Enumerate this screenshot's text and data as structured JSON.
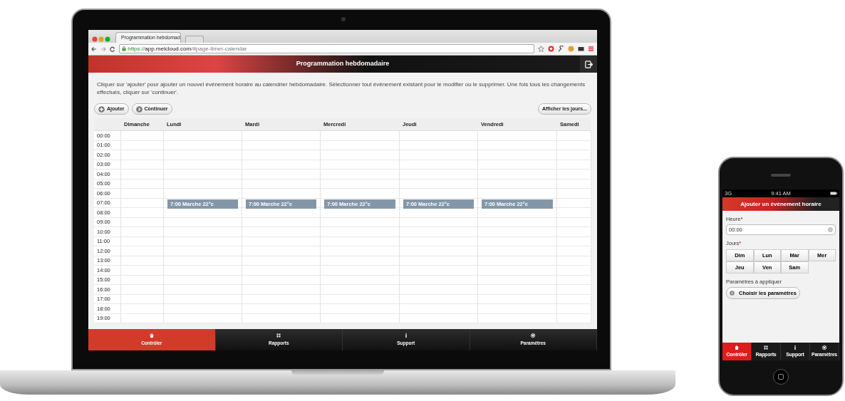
{
  "laptop": {
    "browser": {
      "tab_title": "Programmation hebdomad",
      "url_scheme": "https://",
      "url_host": "app.melcloud.com",
      "url_path": "/#page-timer-calendar"
    },
    "header_title": "Programmation hebdomadaire",
    "instructions": "Cliquer sur 'ajouter' pour ajouter un nouvel évènement horaire au calendrier hebdomadaire. Sélectionner tout évènement existant pour le modifier ou le supprimer. Une fois tous les changements effectués, cliquer sur 'continuer'.",
    "buttons": [
      {
        "label": "Ajouter",
        "kind": "add"
      },
      {
        "label": "Continuer",
        "kind": "next"
      }
    ],
    "show_days_button": "Afficher les jours...",
    "calendar": {
      "days": [
        "Dimanche",
        "Lundi",
        "Mardi",
        "Mercredi",
        "Jeudi",
        "Vendredi",
        "Samedi"
      ],
      "rows": [
        {
          "time": "00:00"
        },
        {
          "time": "01:00"
        },
        {
          "time": "02:00"
        },
        {
          "time": "03:00"
        },
        {
          "time": "04:00"
        },
        {
          "time": "05:00"
        },
        {
          "time": "06:00"
        },
        {
          "time": "07:00",
          "cells": [
            {
              "kind": "empty"
            },
            {
              "kind": "event",
              "label": "7:00 Marche 22°c"
            },
            {
              "kind": "event",
              "label": "7:00 Marche 22°c"
            },
            {
              "kind": "event",
              "label": "7:00 Marche 22°c"
            },
            {
              "kind": "event",
              "label": "7:00 Marche 22°c"
            },
            {
              "kind": "event",
              "label": "7:00 Marche 22°c"
            },
            {
              "kind": "empty"
            }
          ]
        },
        {
          "time": "08:00"
        },
        {
          "time": "09:00"
        },
        {
          "time": "10:00"
        },
        {
          "time": "11:00"
        },
        {
          "time": "12:00"
        },
        {
          "time": "13:00"
        },
        {
          "time": "14:00"
        },
        {
          "time": "15:00"
        },
        {
          "time": "16:00"
        },
        {
          "time": "17:00"
        },
        {
          "time": "18:00"
        },
        {
          "time": "19:00"
        }
      ]
    },
    "tabs": [
      {
        "label": "Contrôler",
        "selected": true
      },
      {
        "label": "Rapports",
        "selected": false
      },
      {
        "label": "Support",
        "selected": false
      },
      {
        "label": "Paramètres",
        "selected": false
      }
    ]
  },
  "phone": {
    "status": {
      "carrier": "3G",
      "time": "9:41 AM"
    },
    "title": "Ajouter un évènement horaire",
    "time_label": "Heure",
    "time_required": "*",
    "time_value": "00:00",
    "days_label": "Jours",
    "days_required": "*",
    "day_buttons": [
      "Dim",
      "Lun",
      "Mar",
      "Mer",
      "Jeu",
      "Ven",
      "Sam"
    ],
    "params_label": "Paramètres à appliquer",
    "params_button": "Choisir les paramètres",
    "tabs": [
      {
        "label": "Contrôler",
        "selected": true
      },
      {
        "label": "Rapports",
        "selected": false
      },
      {
        "label": "Support",
        "selected": false
      },
      {
        "label": "Paramètres",
        "selected": false
      }
    ]
  }
}
